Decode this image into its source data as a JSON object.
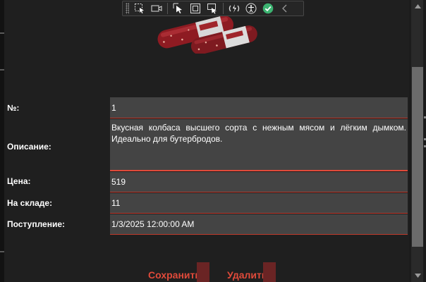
{
  "form": {
    "number_label": "№:",
    "number_value": "1",
    "description_label": "Описание:",
    "description_value": "Вкусная колбаса высшего сорта с нежным мясом и лёгким дымком. Идеально для бутербродов.",
    "price_label": "Цена:",
    "price_value": "519",
    "stock_label": "На складе:",
    "stock_value": "11",
    "arrival_label": "Поступление:",
    "arrival_value": "1/3/2025 12:00:00 AM"
  },
  "actions": {
    "save_label": "Сохранить",
    "delete_label": "Удалить"
  },
  "toolbar": {
    "icons": [
      "drag-grip-icon",
      "select-element-icon",
      "video-icon",
      "cursor-select-icon",
      "frame-icon",
      "rect-select-icon",
      "hot-reload-icon",
      "accessibility-icon",
      "checkmark-icon",
      "collapse-chevron-icon"
    ]
  },
  "colors": {
    "accent": "#e04a3a",
    "field_bg": "#444444",
    "background": "#1f1f1f",
    "check_green": "#3cb371"
  }
}
